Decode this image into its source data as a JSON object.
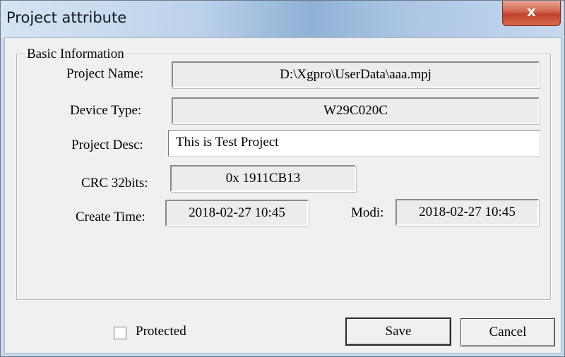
{
  "window": {
    "title": "Project attribute",
    "close_glyph": "x"
  },
  "group": {
    "legend": "Basic Information"
  },
  "fields": {
    "project_name": {
      "label": "Project Name:",
      "value": "D:\\Xgpro\\UserData\\aaa.mpj"
    },
    "device_type": {
      "label": "Device Type:",
      "value": "W29C020C"
    },
    "project_desc": {
      "label": "Project Desc:",
      "value": "This is Test Project"
    },
    "crc": {
      "label": "CRC 32bits:",
      "value": "0x 1911CB13"
    },
    "create_time": {
      "label": "Create Time:",
      "value": "2018-02-27 10:45"
    },
    "modi_time": {
      "label": "Modi:",
      "value": "2018-02-27 10:45"
    }
  },
  "protected": {
    "label": "Protected",
    "checked": false
  },
  "buttons": {
    "save": "Save",
    "cancel": "Cancel"
  },
  "colors": {
    "titlebar_accent": "#8fb1d6",
    "close_button": "#c0422a",
    "dialog_background": "#f0f0f0"
  }
}
